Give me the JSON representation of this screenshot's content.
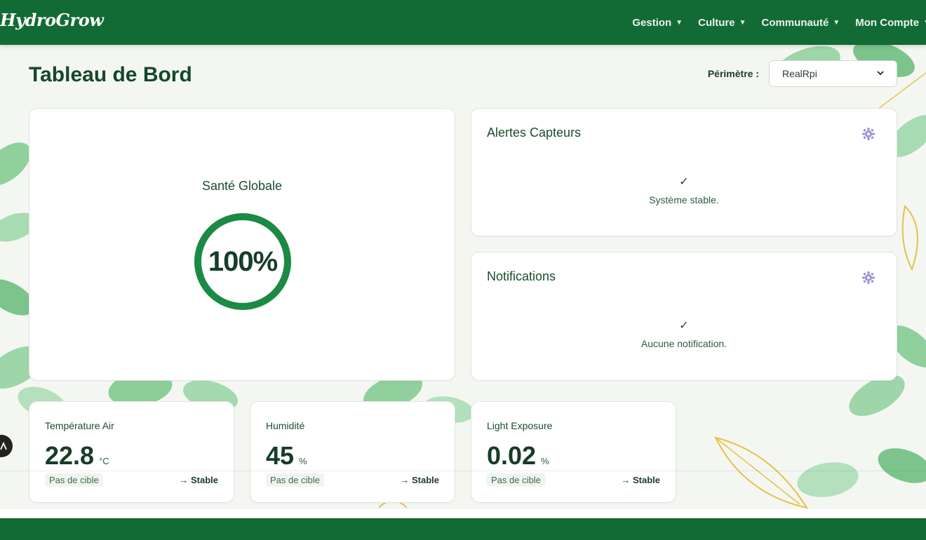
{
  "app": {
    "name": "HydroGrow"
  },
  "nav": {
    "items": [
      {
        "label": "Gestion"
      },
      {
        "label": "Culture"
      },
      {
        "label": "Communauté"
      },
      {
        "label": "Mon Compte"
      }
    ]
  },
  "page": {
    "title": "Tableau de Bord"
  },
  "scope": {
    "label": "Périmètre :",
    "selected": "RealRpi"
  },
  "health": {
    "title": "Santé Globale",
    "value": "100%",
    "fraction": 1.0
  },
  "alerts": {
    "title": "Alertes Capteurs",
    "check": "✓",
    "message": "Système stable."
  },
  "notifications": {
    "title": "Notifications",
    "check": "✓",
    "message": "Aucune notification."
  },
  "metrics": [
    {
      "title": "Température Air",
      "value": "22.8",
      "unit": "°C",
      "target": "Pas de cible",
      "trend": "→ Stable"
    },
    {
      "title": "Humidité",
      "value": "45",
      "unit": "%",
      "target": "Pas de cible",
      "trend": "→ Stable"
    },
    {
      "title": "Light Exposure",
      "value": "0.02",
      "unit": "%",
      "target": "Pas de cible",
      "trend": "→ Stable"
    }
  ],
  "colors": {
    "brand": "#126b35",
    "accent": "#1b8a45",
    "text": "#173c27"
  }
}
